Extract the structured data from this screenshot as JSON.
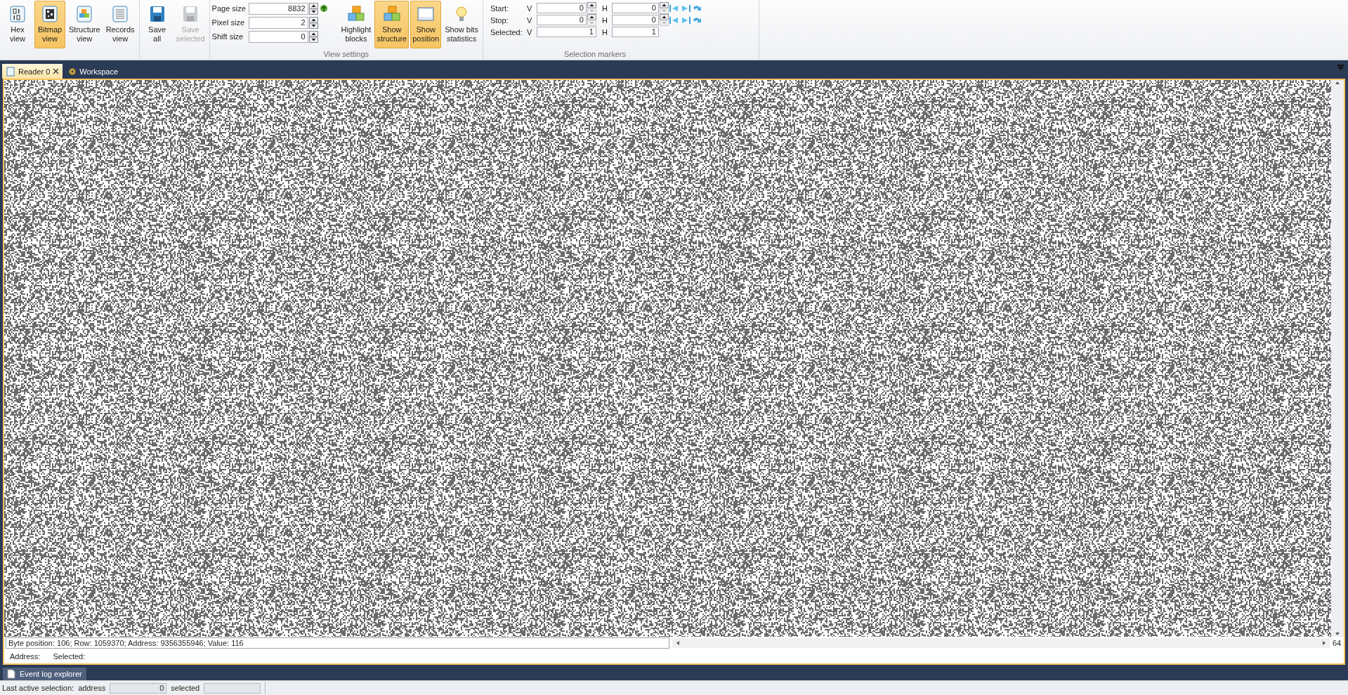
{
  "ribbon": {
    "view_buttons": [
      {
        "label": "Hex\nview",
        "kind": "hex",
        "selected": false
      },
      {
        "label": "Bitmap\nview",
        "kind": "bitmap",
        "selected": true
      },
      {
        "label": "Structure\nview",
        "kind": "structure",
        "selected": false
      },
      {
        "label": "Records\nview",
        "kind": "records",
        "selected": false
      }
    ],
    "save_buttons": [
      {
        "label": "Save\nall",
        "disabled": false
      },
      {
        "label": "Save\nselected",
        "disabled": true
      }
    ],
    "view_settings": {
      "fields": [
        {
          "label": "Page size",
          "value": "8832"
        },
        {
          "label": "Pixel size",
          "value": "2"
        },
        {
          "label": "Shift size",
          "value": "0"
        }
      ],
      "buttons": [
        {
          "label": "Highlight\nblocks",
          "kind": "blocks",
          "selected": false
        },
        {
          "label": "Show\nstructure",
          "kind": "blocks",
          "selected": true
        },
        {
          "label": "Show\nposition",
          "kind": "position",
          "selected": true
        },
        {
          "label": "Show bits\nstatistics",
          "kind": "bulb",
          "selected": false
        }
      ],
      "title": "View settings"
    },
    "selection_markers": {
      "rows": [
        {
          "label": "Start:",
          "v_label": "V",
          "v": "0",
          "h_label": "H",
          "h": "0",
          "spin": true
        },
        {
          "label": "Stop:",
          "v_label": "V",
          "v": "0",
          "h_label": "H",
          "h": "0",
          "spin": true
        },
        {
          "label": "Selected:",
          "v_label": "V",
          "v": "1",
          "h_label": "H",
          "h": "1",
          "spin": false
        }
      ],
      "title": "Selection markers"
    }
  },
  "tabs": [
    {
      "label": "Reader 0",
      "selected": true
    },
    {
      "label": "Workspace",
      "selected": false
    }
  ],
  "status_line": "Byte position: 106; Row: 1059370; Address: 9356355946; Value: 116",
  "zoom_value": "64",
  "info_line": {
    "address_label": "Address:",
    "selected_label": "Selected:"
  },
  "dock_tab": "Event log explorer",
  "status_bar": {
    "label": "Last active selection:",
    "address_label": "address",
    "address_value": "0",
    "selected_label": "selected"
  }
}
